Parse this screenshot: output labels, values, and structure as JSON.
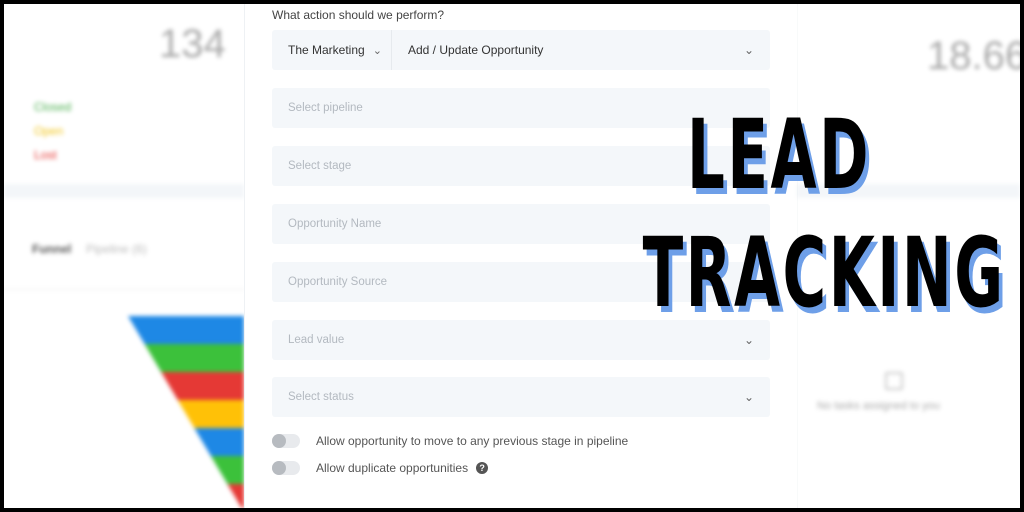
{
  "left_panel": {
    "count": "134",
    "legend": [
      {
        "label": "Closed",
        "color": "#4caf50"
      },
      {
        "label": "Open",
        "color": "#f0c419"
      },
      {
        "label": "Lost",
        "color": "#e53935"
      }
    ],
    "funnel_title": "Funnel",
    "funnel_subtitle": "Pipeline (6)",
    "funnel_colors": [
      "#1e88e5",
      "#3cc13b",
      "#e53935",
      "#ffc107",
      "#1e88e5",
      "#3cc13b",
      "#e53935"
    ]
  },
  "form": {
    "question": "What action should we perform?",
    "account": "The Marketing",
    "action": "Add / Update Opportunity",
    "fields": [
      {
        "placeholder": "Select pipeline",
        "dropdown": false
      },
      {
        "placeholder": "Select stage",
        "dropdown": false
      },
      {
        "placeholder": "Opportunity Name",
        "dropdown": false
      },
      {
        "placeholder": "Opportunity Source",
        "dropdown": false
      },
      {
        "placeholder": "Lead value",
        "dropdown": true
      },
      {
        "placeholder": "Select status",
        "dropdown": true
      }
    ],
    "toggles": [
      {
        "label": "Allow opportunity to move to any previous stage in pipeline",
        "on": false,
        "help": false
      },
      {
        "label": "Allow duplicate opportunities",
        "on": false,
        "help": true
      }
    ],
    "help_glyph": "?",
    "chevron_glyph": "⌄"
  },
  "right_panel": {
    "value": "18.66",
    "tasks_text": "No tasks assigned to you"
  },
  "overlay": {
    "line1": "LEAD",
    "line2": "TRACKING",
    "text_color": "#000000",
    "shadow_color": "#6e9fe8"
  }
}
